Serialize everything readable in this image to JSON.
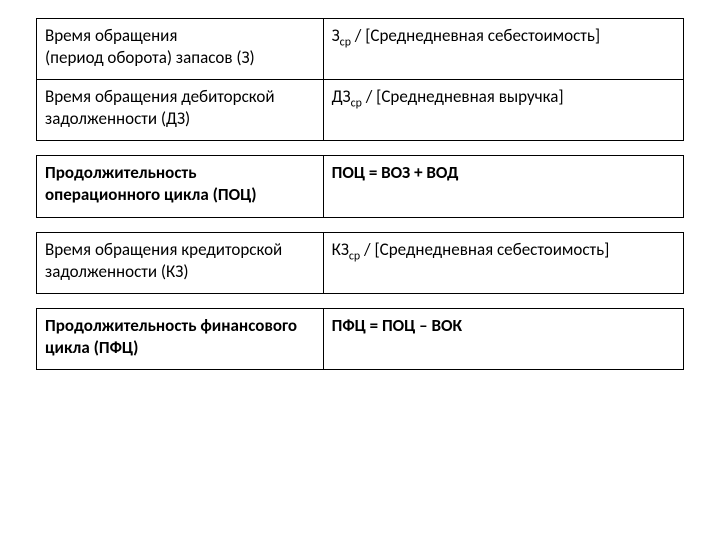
{
  "rows": [
    {
      "left": "Время обращения<br>(период оборота) запасов (З)",
      "right": "З<sub>ср</sub> / [Среднедневная себестоимость]",
      "bold": false,
      "gapAfter": false
    },
    {
      "left": "Время обращения дебиторской задолженности (ДЗ)",
      "right": "ДЗ<sub>ср</sub> / [Среднедневная выручка]",
      "bold": false,
      "gapAfter": true
    },
    {
      "left": "Продолжительность операционного цикла (ПОЦ)",
      "right": "ПОЦ = ВОЗ + ВОД",
      "bold": true,
      "gapAfter": true
    },
    {
      "left": "Время обращения кредиторской задолженности (КЗ)",
      "right": "КЗ<sub>ср</sub> / [Среднедневная себестоимость]",
      "bold": false,
      "gapAfter": true
    },
    {
      "left": "Продолжительность финансового цикла (ПФЦ)",
      "right": "ПФЦ = ПОЦ – ВОК",
      "bold": true,
      "gapAfter": false
    }
  ]
}
